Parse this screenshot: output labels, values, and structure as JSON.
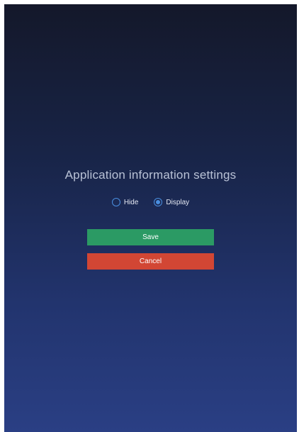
{
  "settings": {
    "title": "Application information settings",
    "options": [
      {
        "label": "Hide",
        "selected": false
      },
      {
        "label": "Display",
        "selected": true
      }
    ],
    "save_label": "Save",
    "cancel_label": "Cancel"
  },
  "colors": {
    "save_button": "#2b9a64",
    "cancel_button": "#d24634",
    "radio_accent": "#4a8fe0",
    "background_top": "#14182a",
    "background_bottom": "#2a3f84"
  }
}
